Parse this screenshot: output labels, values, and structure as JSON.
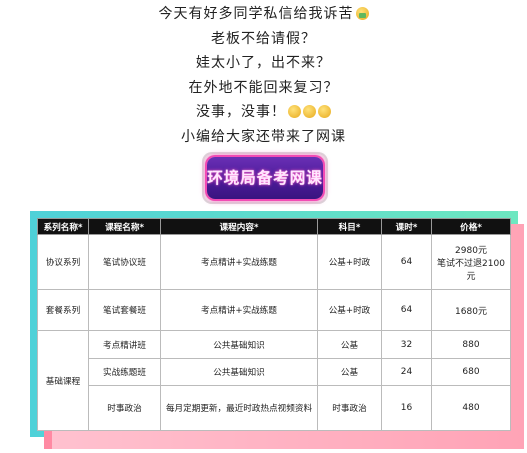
{
  "intro_lines": [
    "今天有好多同学私信给我诉苦",
    "老板不给请假？",
    "娃太小了，出不来？",
    "在外地不能回来复习？",
    "没事，没事！",
    "小编给大家还带来了网课"
  ],
  "cta": {
    "label": "环境局备考网课"
  },
  "colors": {
    "accent_purple": "#4b1b98",
    "accent_pink": "#f24bb4",
    "deco_cyan": "#4fd1d8",
    "deco_pink": "#ff8aa3"
  },
  "table": {
    "headers": [
      "系列名称*",
      "课程名称*",
      "课程内容*",
      "科目*",
      "课时*",
      "价格*"
    ],
    "rows": [
      {
        "series": "协议系列",
        "course": "笔试协议班",
        "content": "考点精讲+实战练题",
        "subject": "公基+时政",
        "hours": "64",
        "price_line1": "2980元",
        "price_line2": "笔试不过退2100元"
      },
      {
        "series": "套餐系列",
        "course": "笔试套餐班",
        "content": "考点精讲+实战练题",
        "subject": "公基+时政",
        "hours": "64",
        "price_line1": "1680元"
      },
      {
        "series": "基础课程",
        "course": "考点精讲班",
        "content": "公共基础知识",
        "subject": "公基",
        "hours": "32",
        "price_line1": "880"
      },
      {
        "course": "实战练题班",
        "content": "公共基础知识",
        "subject": "公基",
        "hours": "24",
        "price_line1": "680"
      },
      {
        "course": "时事政治",
        "content": "每月定期更新，最近时政热点视频资料",
        "subject": "时事政治",
        "hours": "16",
        "price_line1": "480"
      }
    ]
  }
}
